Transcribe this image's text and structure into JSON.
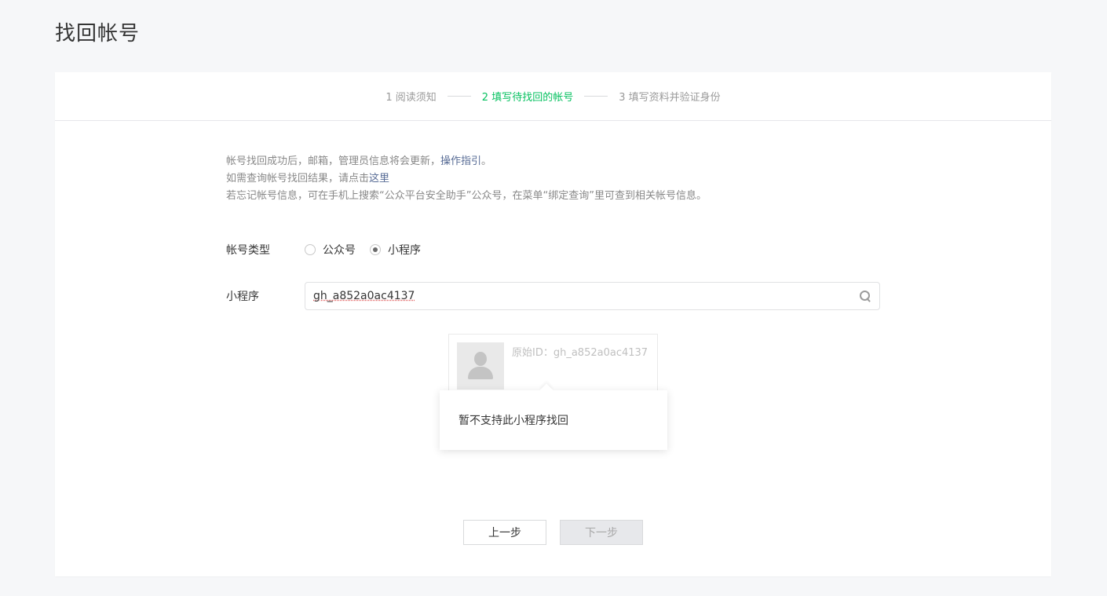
{
  "page": {
    "title": "找回帐号"
  },
  "steps": [
    {
      "label": "1 阅读须知",
      "active": false
    },
    {
      "label": "2 填写待找回的帐号",
      "active": true
    },
    {
      "label": "3 填写资料并验证身份",
      "active": false
    }
  ],
  "notes": {
    "line1_prefix": "帐号找回成功后，邮箱，管理员信息将会更新，",
    "line1_link": "操作指引",
    "line1_suffix": "。",
    "line2_prefix": "如需查询帐号找回结果，请点击",
    "line2_link": "这里",
    "line3": "若忘记帐号信息，可在手机上搜索“公众平台安全助手”公众号，在菜单“绑定查询”里可查到相关帐号信息。"
  },
  "form": {
    "account_type_label": "帐号类型",
    "options": [
      {
        "label": "公众号",
        "checked": false
      },
      {
        "label": "小程序",
        "checked": true
      }
    ],
    "app_label": "小程序",
    "search_value": "gh_a852a0ac4137"
  },
  "result": {
    "id_text": "原始ID：gh_a852a0ac4137"
  },
  "popover": {
    "message": "暂不支持此小程序找回"
  },
  "buttons": {
    "prev": "上一步",
    "next": "下一步"
  },
  "colors": {
    "accent": "#07c160",
    "link": "#576b95"
  }
}
